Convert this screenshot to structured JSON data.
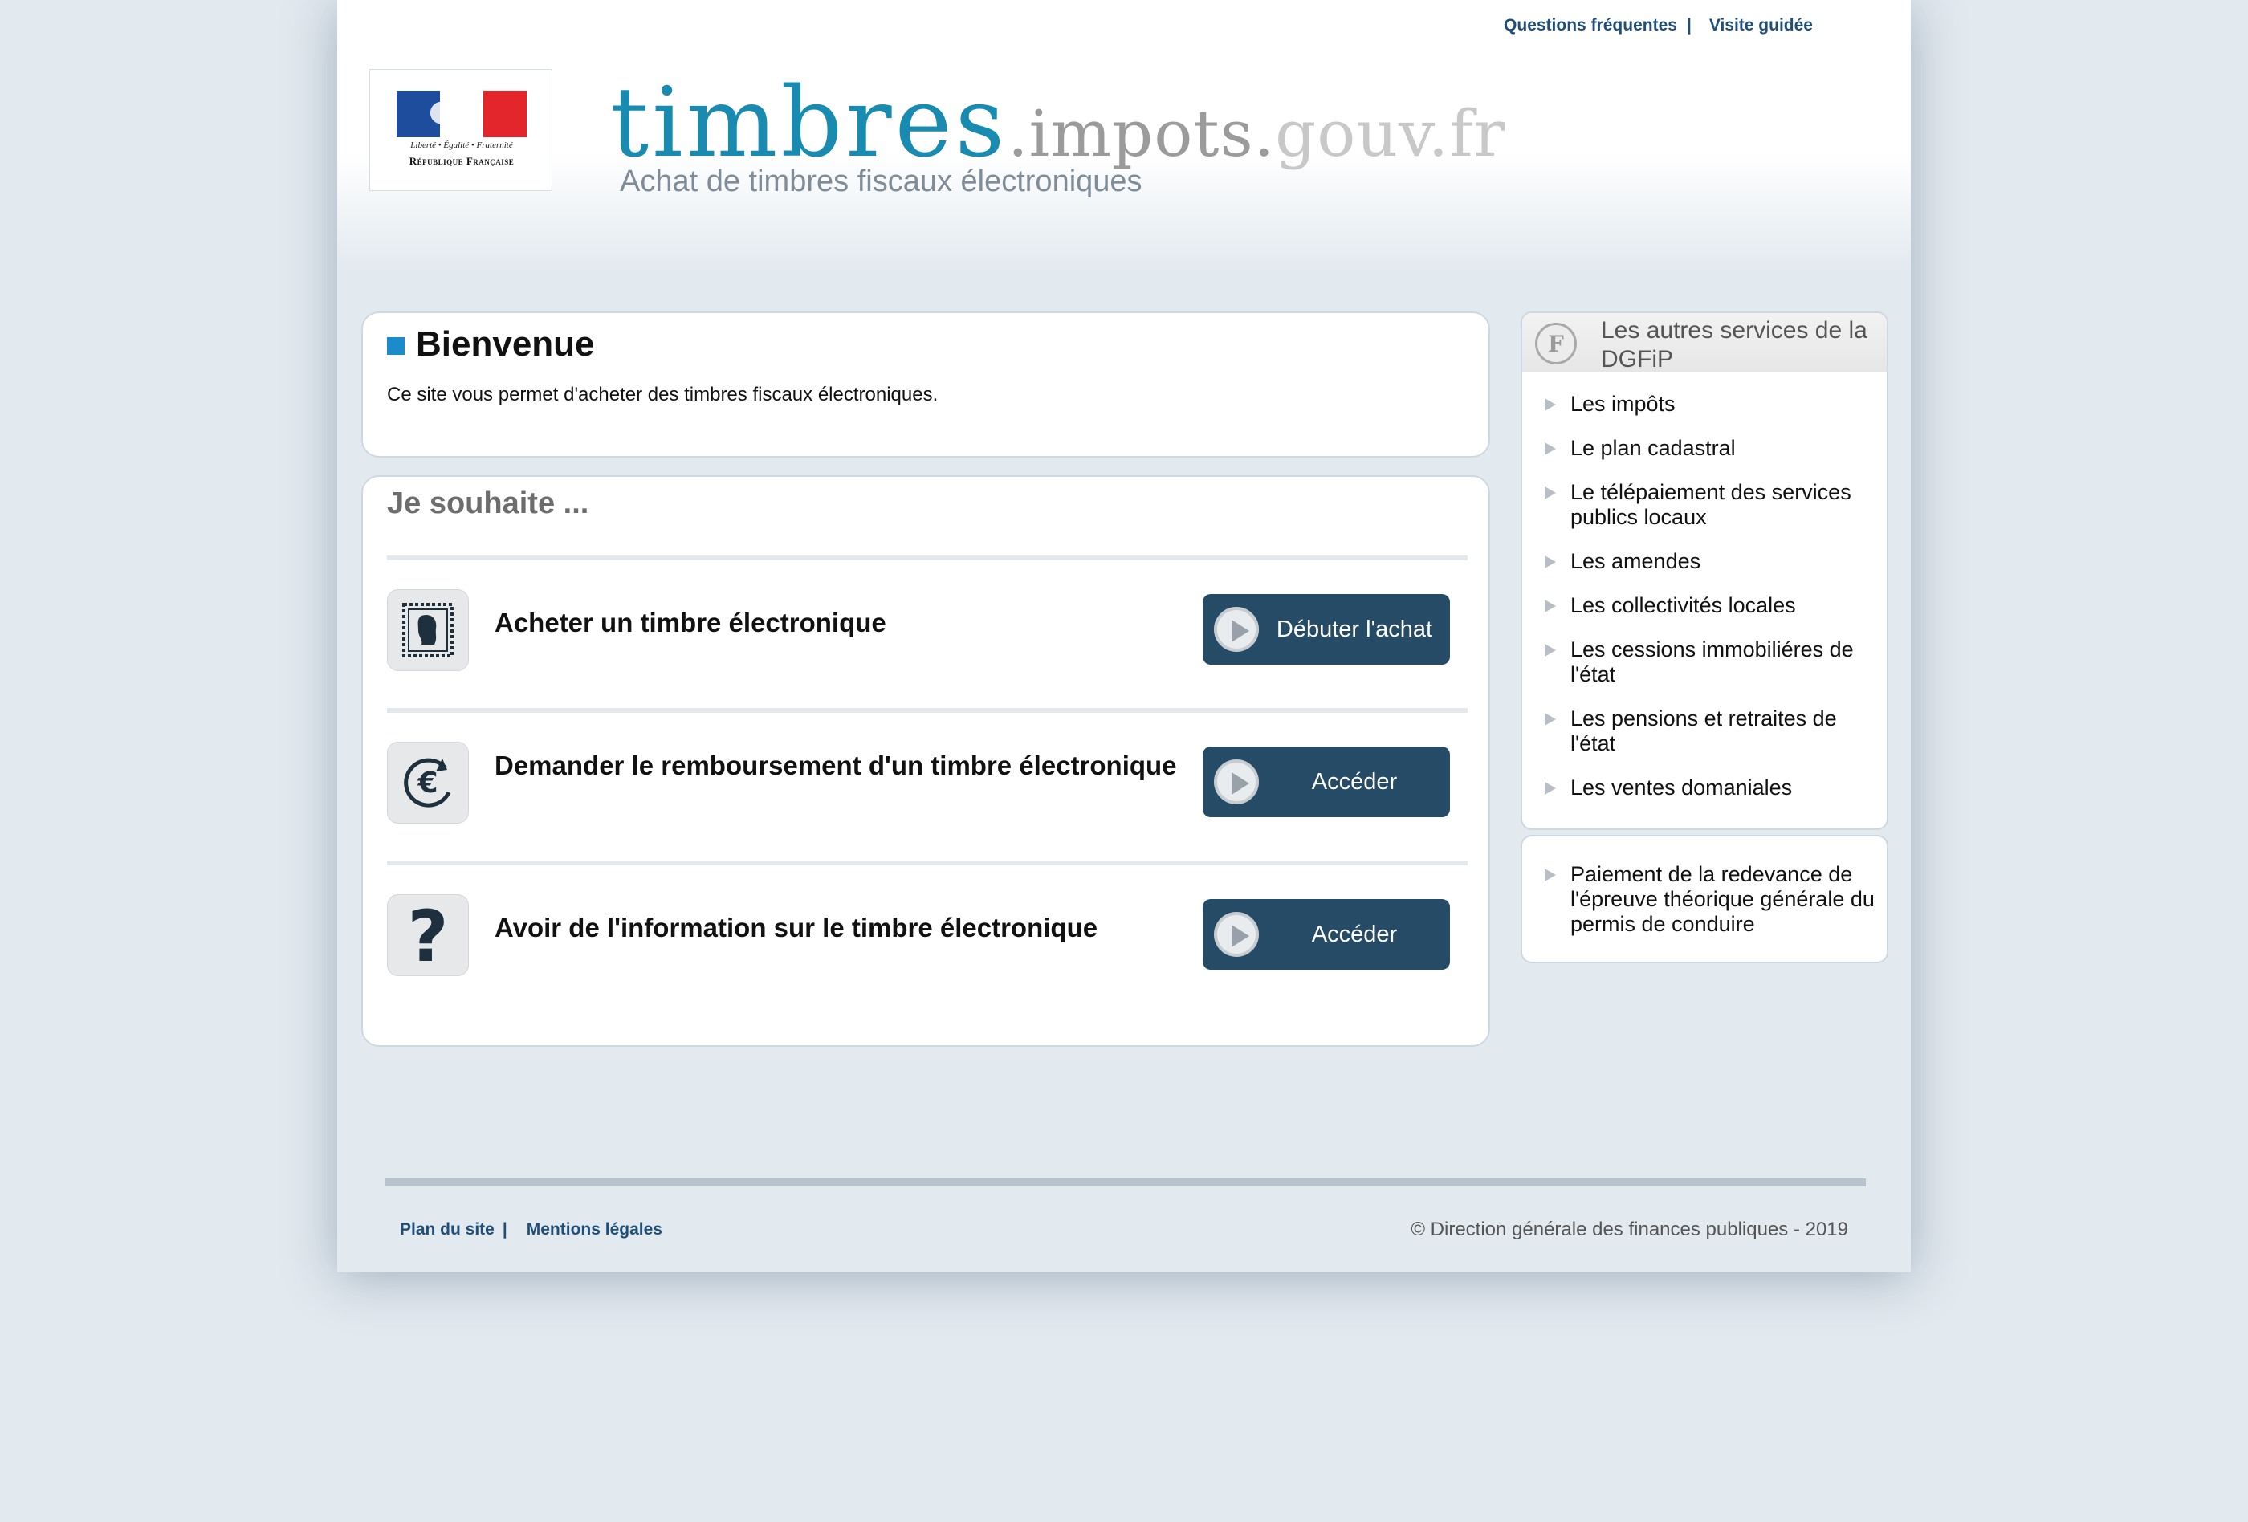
{
  "toplinks": {
    "faq": "Questions fréquentes",
    "sep": "|",
    "tour": "Visite guidée"
  },
  "logo": {
    "devise": "Liberté • Égalité • Fraternité",
    "republique": "République Française"
  },
  "brand": {
    "part1": "timbres",
    "part2": ".impots.",
    "part3": "gouv.fr",
    "tagline": "Achat de timbres fiscaux électroniques"
  },
  "welcome": {
    "title": "Bienvenue",
    "text": "Ce site vous permet d'acheter des timbres fiscaux électroniques."
  },
  "wish": {
    "title": "Je souhaite ...",
    "rows": [
      {
        "label": "Acheter un timbre électronique",
        "button": "Débuter l'achat",
        "icon": "stamp-icon"
      },
      {
        "label": "Demander le remboursement d'un timbre électronique",
        "button": "Accéder",
        "icon": "euro-refund-icon"
      },
      {
        "label": "Avoir de l'information sur le timbre électronique",
        "button": "Accéder",
        "icon": "question-mark-icon"
      }
    ]
  },
  "side": {
    "title": "Les autres services de la DGFiP",
    "items": [
      "Les impôts",
      "Le plan cadastral",
      "Le télépaiement des services publics locaux",
      "Les amendes",
      "Les collectivités locales",
      "Les cessions immobiliéres de l'état",
      "Les pensions et retraites de l'état",
      "Les ventes domaniales"
    ],
    "extra": "Paiement de la redevance de l'épreuve théorique générale du permis de conduire"
  },
  "footer": {
    "sitemap": "Plan du site",
    "sep": "|",
    "legal": "Mentions légales",
    "copyright": "© Direction générale des finances publiques - 2019"
  },
  "colors": {
    "accent": "#1a8cc9",
    "button": "#264b66",
    "link": "#1f4e79"
  }
}
